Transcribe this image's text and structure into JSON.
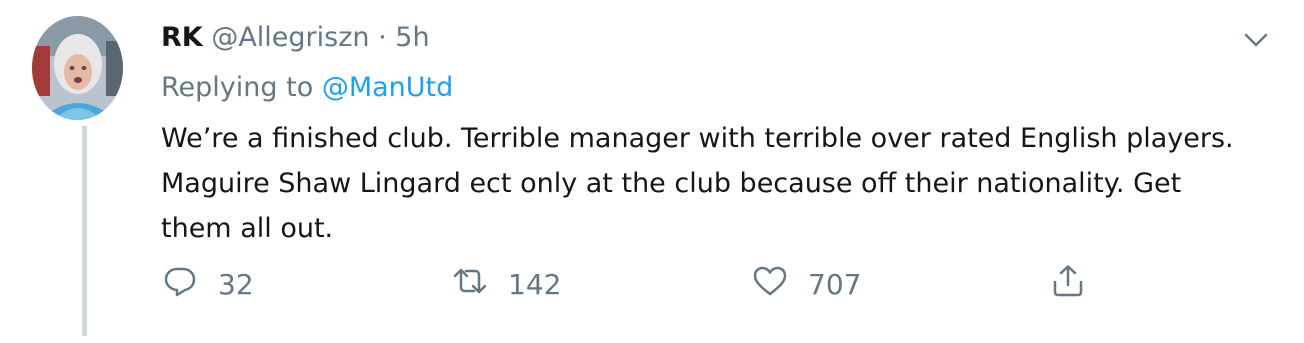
{
  "tweet": {
    "name": "RK",
    "handle": "@Allegriszn",
    "separator": "·",
    "time": "5h",
    "replying_prefix": "Replying to",
    "replying_to": "@ManUtd",
    "text": "We’re a finished club. Terrible manager with terrible over rated English players. Maguire Shaw Lingard ect only at the club because off their nationality. Get them all out.",
    "avatar_icon": "user-avatar-photo",
    "caret_icon": "chevron-down-icon"
  },
  "actions": {
    "reply_count": "32",
    "retweet_count": "142",
    "like_count": "707",
    "reply_icon": "reply-icon",
    "retweet_icon": "retweet-icon",
    "like_icon": "heart-icon",
    "share_icon": "share-icon"
  },
  "colors": {
    "text": "#14171a",
    "muted": "#657786",
    "link": "#1da1f2",
    "thread_line": "#cfd9de"
  }
}
